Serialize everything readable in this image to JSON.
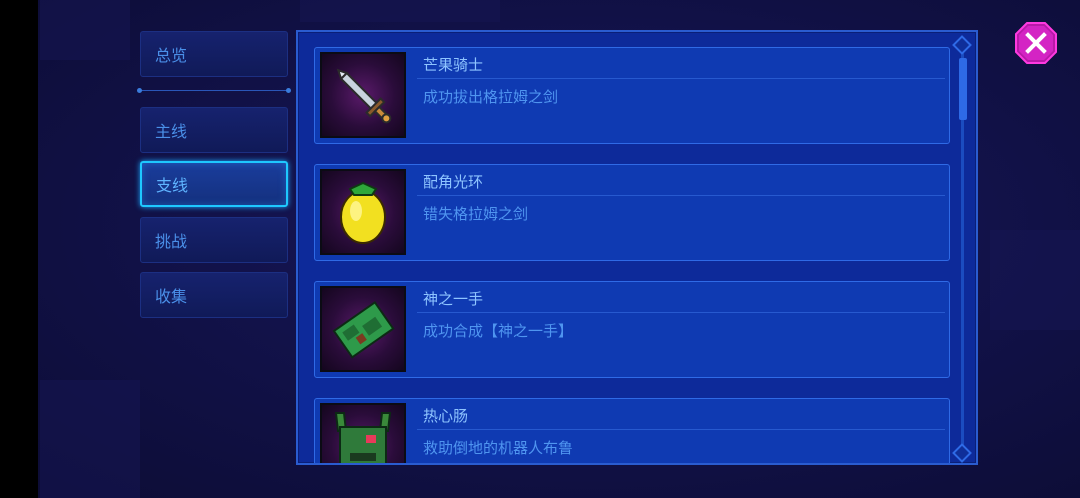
{
  "sidebar": {
    "tabs": [
      {
        "label": "总览",
        "active": false
      },
      {
        "label": "主线",
        "active": false
      },
      {
        "label": "支线",
        "active": true
      },
      {
        "label": "挑战",
        "active": false
      },
      {
        "label": "收集",
        "active": false
      }
    ]
  },
  "achievements": [
    {
      "title": "芒果骑士",
      "description": "成功拔出格拉姆之剑",
      "icon": "sword-icon"
    },
    {
      "title": "配角光环",
      "description": "错失格拉姆之剑",
      "icon": "mango-icon"
    },
    {
      "title": "神之一手",
      "description": "成功合成【神之一手】",
      "icon": "green-glove-icon"
    },
    {
      "title": "热心肠",
      "description": "救助倒地的机器人布鲁",
      "icon": "robot-head-icon"
    }
  ],
  "colors": {
    "accent": "#1ec8ff",
    "panel": "#0d2a9a",
    "card": "#0f3ab2",
    "close": "#ff2ad8"
  }
}
